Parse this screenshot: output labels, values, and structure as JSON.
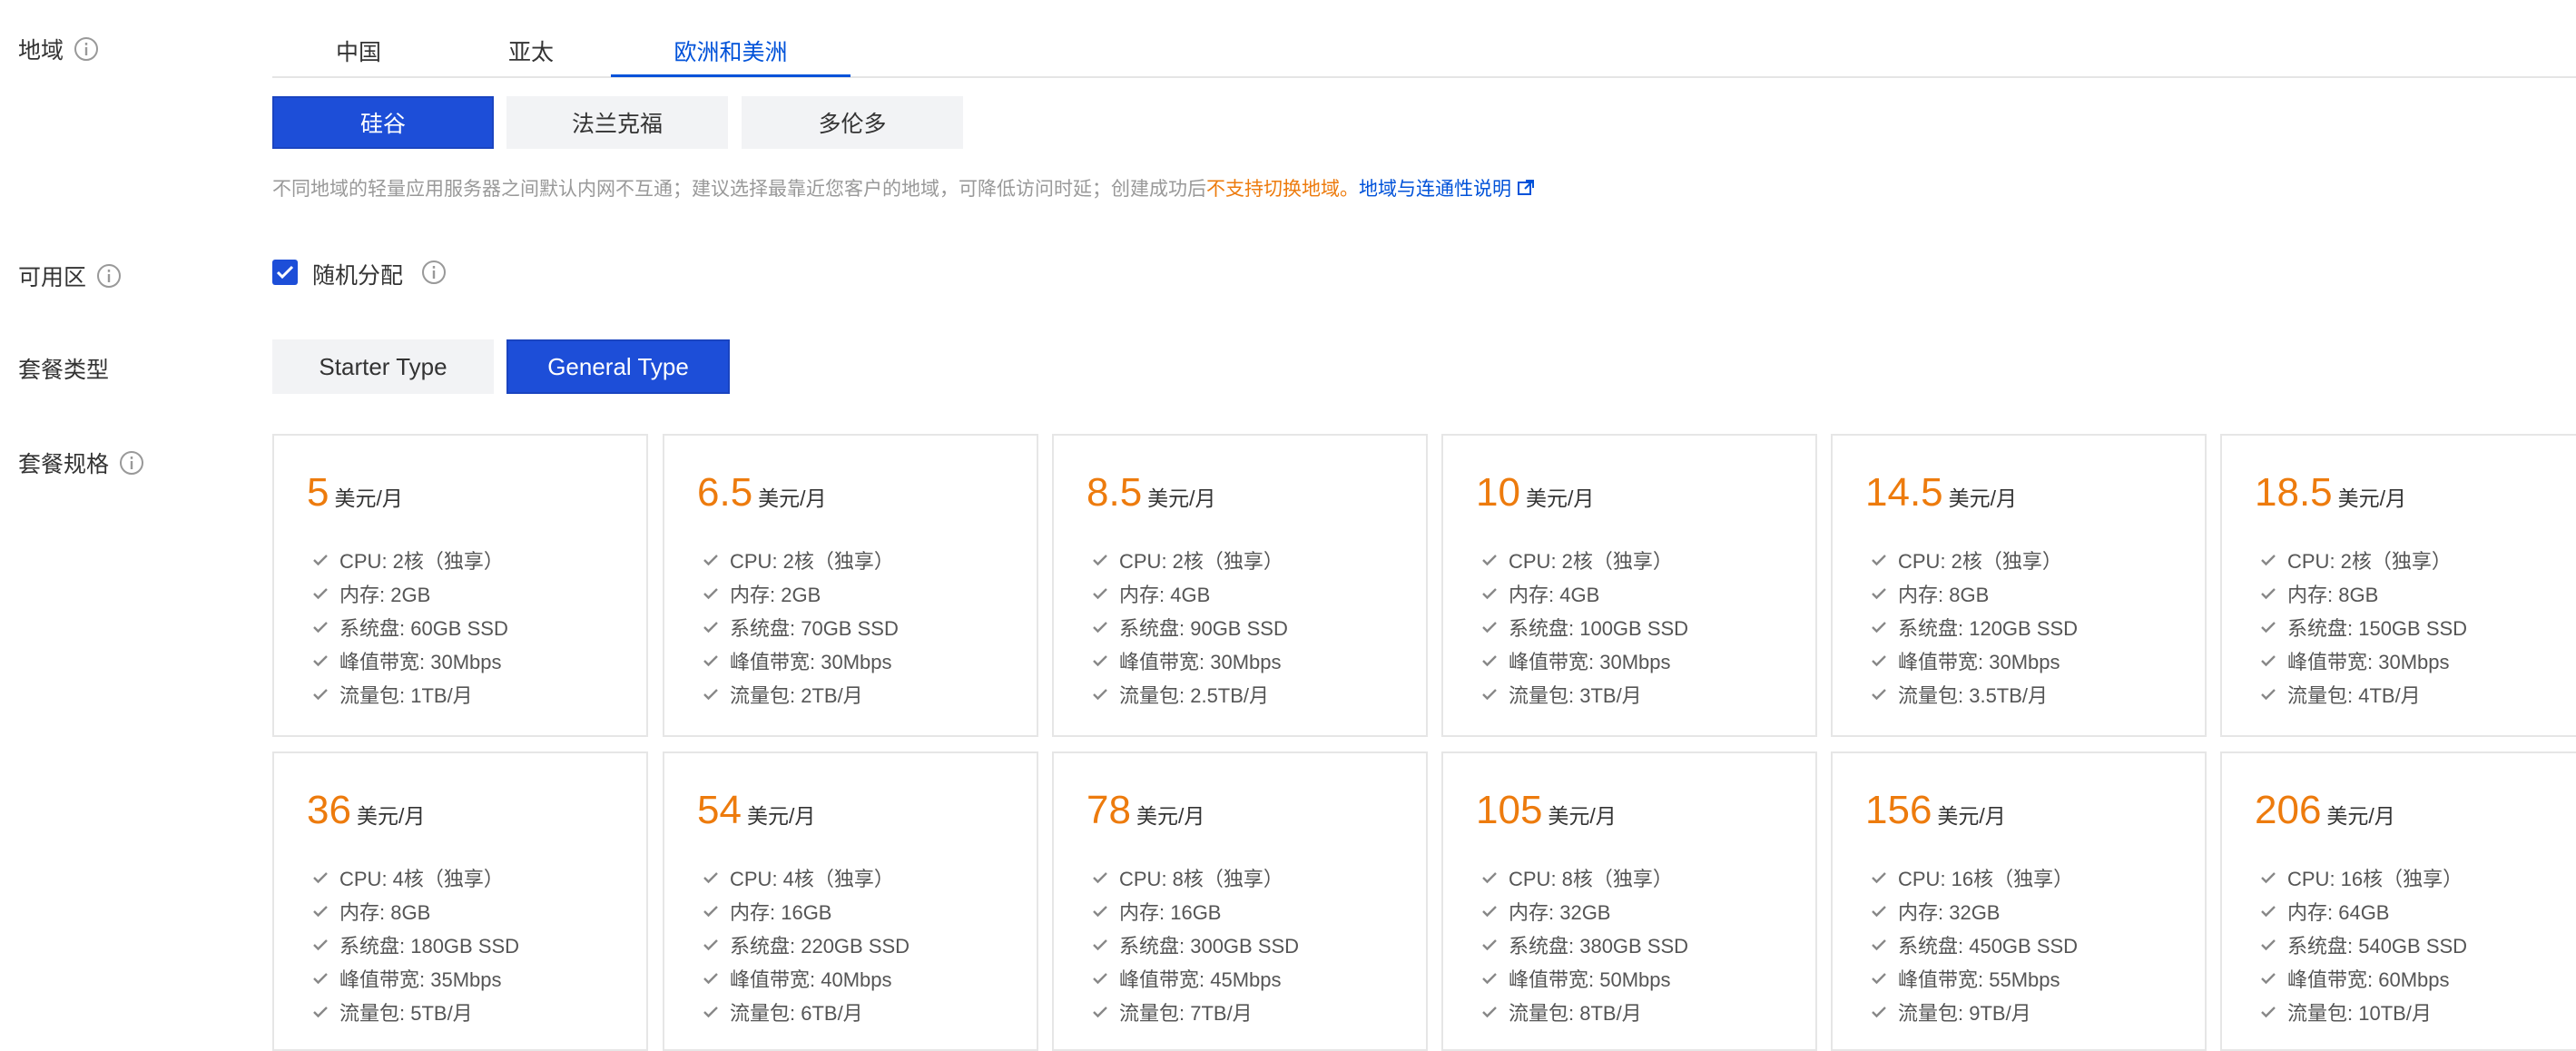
{
  "region": {
    "label": "地域",
    "tabs": [
      {
        "label": "中国",
        "active": false
      },
      {
        "label": "亚太",
        "active": false
      },
      {
        "label": "欧洲和美洲",
        "active": true
      }
    ],
    "cities": [
      {
        "label": "硅谷",
        "active": true
      },
      {
        "label": "法兰克福",
        "active": false
      },
      {
        "label": "多伦多",
        "active": false
      }
    ],
    "notice": {
      "text": "不同地域的轻量应用服务器之间默认内网不互通；建议选择最靠近您客户的地域，可降低访问时延；创建成功后",
      "warning": "不支持切换地域。",
      "link": "地域与连通性说明"
    }
  },
  "availability": {
    "label": "可用区",
    "checkbox_label": "随机分配",
    "checked": true
  },
  "package_type": {
    "label": "套餐类型",
    "options": [
      {
        "label": "Starter Type",
        "active": false
      },
      {
        "label": "General Type",
        "active": true
      }
    ]
  },
  "plans": {
    "label": "套餐规格",
    "unit": "美元/月",
    "items": [
      {
        "price": "5",
        "specs": [
          "CPU: 2核（独享）",
          "内存: 2GB",
          "系统盘: 60GB SSD",
          "峰值带宽: 30Mbps",
          "流量包: 1TB/月"
        ]
      },
      {
        "price": "6.5",
        "specs": [
          "CPU: 2核（独享）",
          "内存: 2GB",
          "系统盘: 70GB SSD",
          "峰值带宽: 30Mbps",
          "流量包: 2TB/月"
        ]
      },
      {
        "price": "8.5",
        "specs": [
          "CPU: 2核（独享）",
          "内存: 4GB",
          "系统盘: 90GB SSD",
          "峰值带宽: 30Mbps",
          "流量包: 2.5TB/月"
        ]
      },
      {
        "price": "10",
        "specs": [
          "CPU: 2核（独享）",
          "内存: 4GB",
          "系统盘: 100GB SSD",
          "峰值带宽: 30Mbps",
          "流量包: 3TB/月"
        ]
      },
      {
        "price": "14.5",
        "specs": [
          "CPU: 2核（独享）",
          "内存: 8GB",
          "系统盘: 120GB SSD",
          "峰值带宽: 30Mbps",
          "流量包: 3.5TB/月"
        ]
      },
      {
        "price": "18.5",
        "specs": [
          "CPU: 2核（独享）",
          "内存: 8GB",
          "系统盘: 150GB SSD",
          "峰值带宽: 30Mbps",
          "流量包: 4TB/月"
        ]
      },
      {
        "price": "36",
        "specs": [
          "CPU: 4核（独享）",
          "内存: 8GB",
          "系统盘: 180GB SSD",
          "峰值带宽: 35Mbps",
          "流量包: 5TB/月"
        ]
      },
      {
        "price": "54",
        "specs": [
          "CPU: 4核（独享）",
          "内存: 16GB",
          "系统盘: 220GB SSD",
          "峰值带宽: 40Mbps",
          "流量包: 6TB/月"
        ]
      },
      {
        "price": "78",
        "specs": [
          "CPU: 8核（独享）",
          "内存: 16GB",
          "系统盘: 300GB SSD",
          "峰值带宽: 45Mbps",
          "流量包: 7TB/月"
        ]
      },
      {
        "price": "105",
        "specs": [
          "CPU: 8核（独享）",
          "内存: 32GB",
          "系统盘: 380GB SSD",
          "峰值带宽: 50Mbps",
          "流量包: 8TB/月"
        ]
      },
      {
        "price": "156",
        "specs": [
          "CPU: 16核（独享）",
          "内存: 32GB",
          "系统盘: 450GB SSD",
          "峰值带宽: 55Mbps",
          "流量包: 9TB/月"
        ]
      },
      {
        "price": "206",
        "specs": [
          "CPU: 16核（独享）",
          "内存: 64GB",
          "系统盘: 540GB SSD",
          "峰值带宽: 60Mbps",
          "流量包: 10TB/月"
        ]
      }
    ]
  },
  "icons": {
    "info": "info-circle-icon",
    "check": "check-icon",
    "external": "external-link-icon",
    "checkbox": "checkbox-checked-icon"
  },
  "colors": {
    "primary": "#1d4ed8",
    "link": "#0052d9",
    "price": "#ed7b0d",
    "warning": "#ed7b0d"
  }
}
